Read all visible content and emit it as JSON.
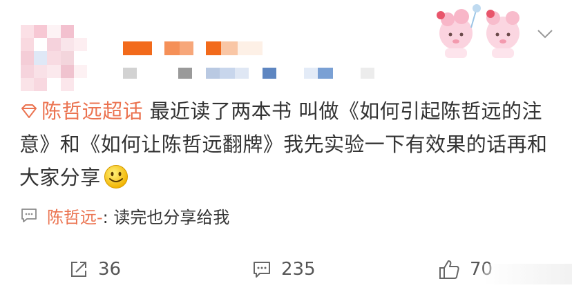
{
  "post": {
    "topic": "陈哲远超话",
    "text": " 最近读了两本书 叫做《如何引起陈哲远的注意》和《如何让陈哲远翻牌》我先实验一下有效果的话再和大家分享"
  },
  "comment": {
    "user": "陈哲远-",
    "text": ": 读完也分享给我"
  },
  "actions": {
    "repost_count": "36",
    "comment_count": "235",
    "like_count": "70"
  },
  "colors": {
    "accent": "#eb7350",
    "text": "#333333",
    "icon": "#666666"
  },
  "icons": {
    "topic": "diamond-icon",
    "comment_preview": "comment-bubble-icon",
    "repost": "repost-icon",
    "comment": "comment-icon",
    "like": "thumbs-up-icon",
    "menu": "chevron-down-icon",
    "emoji": "smile-emoji-icon"
  }
}
